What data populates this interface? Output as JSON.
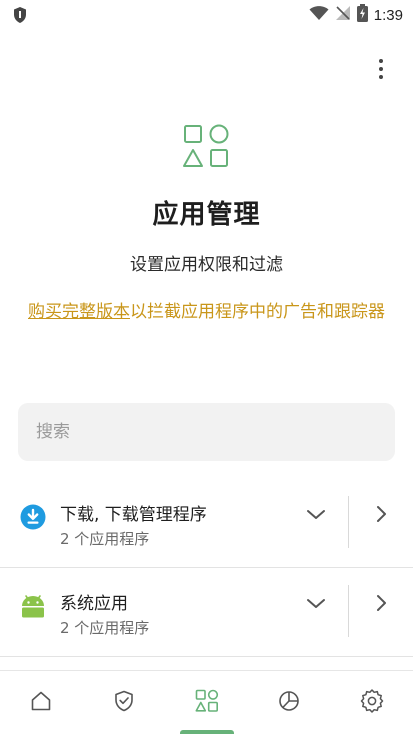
{
  "status_bar": {
    "time": "1:39"
  },
  "header": {
    "title": "应用管理",
    "subtitle": "设置应用权限和过滤",
    "promo_link": "购买完整版本",
    "promo_text": "以拦截应用程序中的广告和跟踪器"
  },
  "search": {
    "placeholder": "搜索"
  },
  "apps": [
    {
      "title": "下载, 下载管理程序",
      "subtitle": "2 个应用程序",
      "icon": "download-icon"
    },
    {
      "title": "系统应用",
      "subtitle": "2 个应用程序",
      "icon": "android-icon"
    }
  ],
  "bottom_nav": {
    "items": [
      "home-icon",
      "shield-icon",
      "apps-icon",
      "stats-icon",
      "settings-icon"
    ],
    "active_index": 2
  },
  "colors": {
    "accent_green": "#67b279",
    "promo_gold": "#c9961a",
    "download_blue": "#1f9be0",
    "android_green": "#8bc34a"
  }
}
